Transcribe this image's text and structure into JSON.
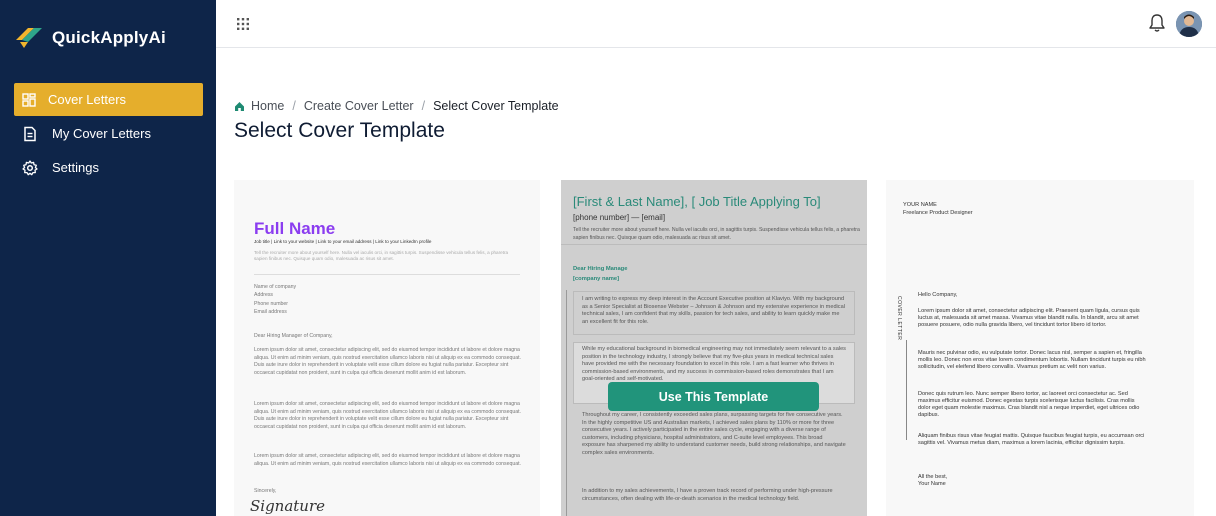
{
  "brand": {
    "name": "QuickApplyAi",
    "accent": "#e5ae2c",
    "sidebar_bg": "#0e2549",
    "teal": "#21947b"
  },
  "sidebar": {
    "items": [
      {
        "label": "Cover Letters",
        "icon": "dashboard-icon",
        "active": true
      },
      {
        "label": "My Cover Letters",
        "icon": "document-icon",
        "active": false
      },
      {
        "label": "Settings",
        "icon": "gear-icon",
        "active": false
      }
    ]
  },
  "topbar": {
    "apps_icon": "grid-icon",
    "notification_icon": "bell-icon",
    "avatar_icon": "user-avatar"
  },
  "breadcrumb": {
    "home": "Home",
    "level2": "Create Cover Letter",
    "current": "Select Cover Template",
    "separator": "/"
  },
  "page": {
    "title": "Select Cover Template"
  },
  "templates": {
    "t1": {
      "name": "Full Name",
      "links": "Job title  |  Link to your website  |  Link to your email address  |  Link to your LinkedIn profile",
      "intro": "Tell the recruiter more about yourself here. Nulla vel iaculis orci, in sagittis turpis. Suspendisse vehicula tellus felis, a pharetra sapien finibus nec. Quisque quam odio, malesuada ac risus sit amet.",
      "addr1": "Name of company",
      "addr2": "Address",
      "addr3": "Phone number",
      "addr4": "Email address",
      "dear": "Dear Hiring Manager of Company,",
      "body1": "Lorem ipsum dolor sit amet, consectetur adipiscing elit, sed do eiusmod tempor incididunt ut labore et dolore magna aliqua. Ut enim ad minim veniam, quis nostrud exercitation ullamco laboris nisi ut aliquip ex ea commodo consequat. Duis aute irure dolor in reprehenderit in voluptate velit esse cillum dolore eu fugiat nulla pariatur. Excepteur sint occaecat cupidatat non proident, sunt in culpa qui officia deserunt mollit anim id est laborum.",
      "body2": "Lorem ipsum dolor sit amet, consectetur adipiscing elit, sed do eiusmod tempor incididunt ut labore et dolore magna aliqua. Ut enim ad minim veniam, quis nostrud exercitation ullamco laboris nisi ut aliquip ex ea commodo consequat. Duis aute irure dolor in reprehenderit in voluptate velit esse cillum dolore eu fugiat nulla pariatur. Excepteur sint occaecat cupidatat non proident, sunt in culpa qui officia deserunt mollit anim id est laborum.",
      "body3": "Lorem ipsum dolor sit amet, consectetur adipiscing elit, sed do eiusmod tempor incididunt ut labore et dolore magna aliqua. Ut enim ad minim veniam, quis nostrud exercitation ullamco laboris nisi ut aliquip ex ea commodo consequat.",
      "sincerely": "Sincerely,",
      "signature": "Signature"
    },
    "t2": {
      "header": "[First & Last Name], [ Job Title Applying To]",
      "phone": "[phone number] — [email]",
      "intro": "Tell the recruiter more about yourself here. Nulla vel iaculis orci, in sagittis turpis. Suspendisse vehicula tellus felis, a pharetra sapien finibus nec. Quisque quam odio, malesuada ac risus sit amet.",
      "dear": "Dear Hiring Manage",
      "company": "[company name]",
      "para1": "I am writing to express my deep interest in the Account Executive position at Klaviyo. With my background as a Senior Specialist at Biosense Webster – Johnson & Johnson and my extensive experience in medical technical sales, I am confident that my skills, passion for tech sales, and ability to learn quickly make me an excellent fit for this role.",
      "para2": "While my educational background in biomedical engineering may not immediately seem relevant to a sales position in the technology industry, I strongly believe that my five-plus years in medical technical sales have provided me with the necessary foundation to excel in this role. I am a fast learner who thrives in commission-based environments, and my success in commission-based roles demonstrates that I am goal-oriented and self-motivated.",
      "para3": "Throughout my career, I consistently exceeded sales plans, surpassing targets for five consecutive years. In the highly competitive US and Australian markets, I achieved sales plans by 110% or more for three consecutive years. I actively participated in the entire sales cycle, engaging with a diverse range of customers, including physicians, hospital administrators, and C-suite level employees. This broad exposure has sharpened my ability to understand customer needs, build strong relationships, and navigate complex sales environments.",
      "para4": "In addition to my sales achievements, I have a proven track record of performing under high-pressure circumstances, often dealing with life-or-death scenarios in the medical technology field.",
      "use_button": "Use This Template"
    },
    "t3": {
      "your_name": "YOUR NAME",
      "role": "Freelance Product Designer",
      "vertical": "COVER LETTER",
      "hello": "Hello Company,",
      "p1": "Lorem ipsum dolor sit amet, consectetur adipiscing elit. Praesent quam ligula, cursus quis luctus at, malesuada sit amet massa. Vivamus vitae blandit nulla. In blandit, arcu sit amet posuere posuere, odio nulla gravida libero, vel tincidunt tortor libero id tortor.",
      "p2": "Mauris nec pulvinar odio, eu vulputate tortor. Donec lacus nisl, semper a sapien et, fringilla mollis leo. Donec non eros vitae lorem condimentum lobortis. Nullam tincidunt turpis eu nibh sollicitudin, vel eleifend libero convallis. Vivamus pretium ac velit non varius.",
      "p3": "Donec quis rutrum leo. Nunc semper libero tortor, ac laoreet orci consectetur ac. Sed maximus efficitur euismod. Donec egestas turpis scelerisque luctus facilisis. Cras mollis dolor eget quam molestie maximus. Cras blandit nisl a neque imperdiet, eget ultrices odio dapibus.",
      "p4": "Aliquam finibus risus vitae feugiat mattis. Quisque faucibus feugiat turpis, eu accumsan orci sagittis vel. Vivamus metus diam, maximus a lorem lacinia, efficitur dignissim turpis.",
      "closing": "All the best,",
      "closing_name": "Your Name"
    }
  }
}
